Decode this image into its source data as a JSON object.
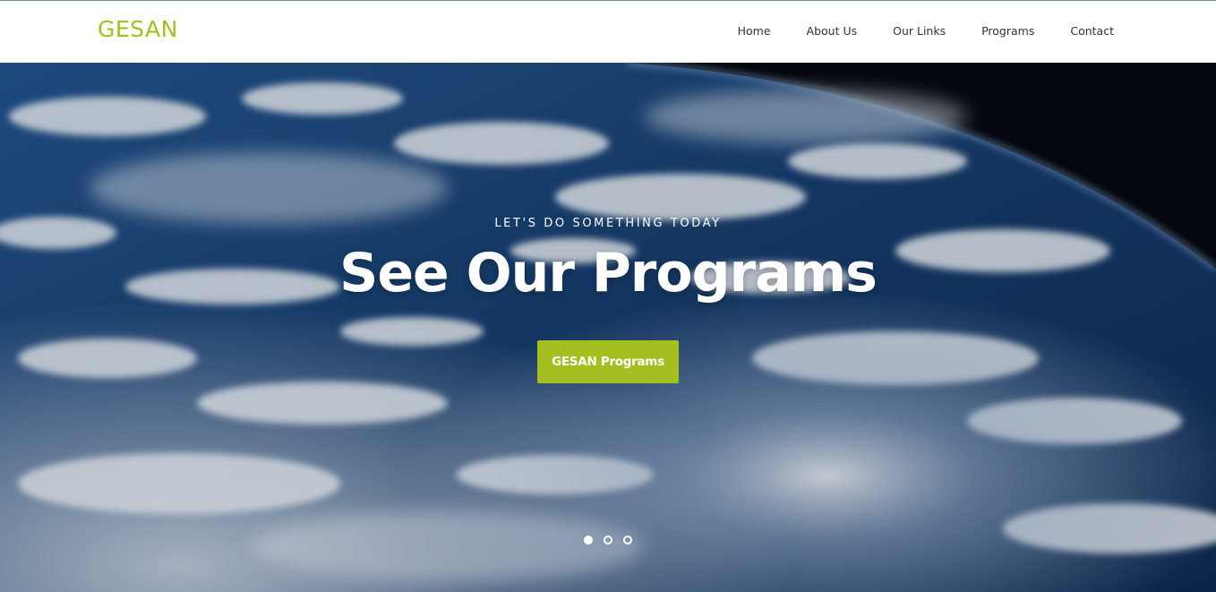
{
  "header": {
    "logo": "GESAN",
    "nav": [
      {
        "label": "Home"
      },
      {
        "label": "About Us"
      },
      {
        "label": "Our Links"
      },
      {
        "label": "Programs"
      },
      {
        "label": "Contact"
      }
    ]
  },
  "hero": {
    "eyebrow": "LET'S DO SOMETHING TODAY",
    "title": "See Our Programs",
    "button_label": "GESAN Programs",
    "slides_total": 3,
    "active_slide": 1
  },
  "colors": {
    "accent": "#a3c020",
    "text_dark": "#333333",
    "ocean": "#1b4a80"
  },
  "icons": [
    "slider-dot-icon"
  ]
}
